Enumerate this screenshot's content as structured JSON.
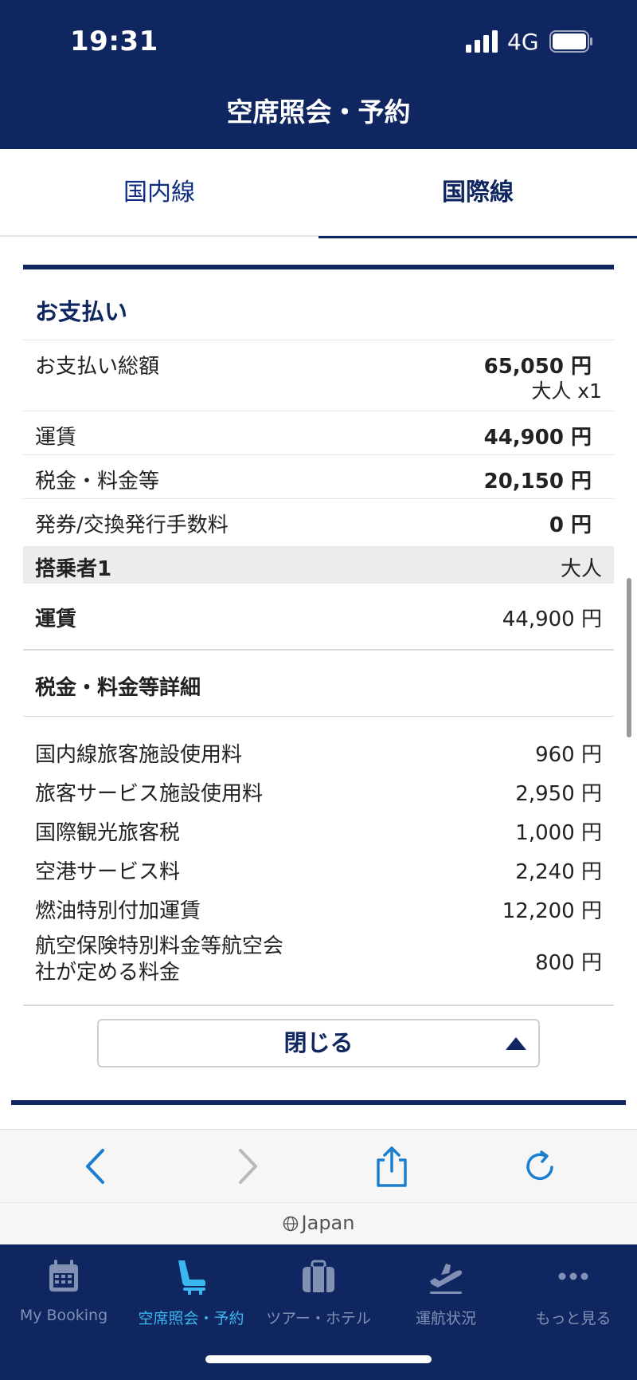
{
  "status": {
    "time": "19:31",
    "network": "4G"
  },
  "header": {
    "title": "空席照会・予約"
  },
  "tabs": [
    {
      "label": "国内線"
    },
    {
      "label": "国際線"
    }
  ],
  "payment": {
    "title": "お支払い",
    "total_label": "お支払い総額",
    "total_value": "65,050 円",
    "total_sub": "大人 x1",
    "fare_label": "運賃",
    "fare_value": "44,900 円",
    "tax_label": "税金・料金等",
    "tax_value": "20,150 円",
    "fee_label": "発券/交換発行手数料",
    "fee_value": "0 円"
  },
  "passenger": {
    "label": "搭乗者1",
    "type": "大人",
    "fare_label": "運賃",
    "fare_value": "44,900 円",
    "tax_details_title": "税金・料金等詳細",
    "details": [
      {
        "label": "国内線旅客施設使用料",
        "value": "960 円"
      },
      {
        "label": "旅客サービス施設使用料",
        "value": "2,950 円"
      },
      {
        "label": "国際観光旅客税",
        "value": "1,000 円"
      },
      {
        "label": "空港サービス料",
        "value": "2,240 円"
      },
      {
        "label": "燃油特別付加運賃",
        "value": "12,200 円"
      },
      {
        "label": "航空保険特別料金等航空会社が定める料金",
        "value": "800 円"
      }
    ]
  },
  "close_button": {
    "label": "閉じる"
  },
  "browser": {
    "domain": "Japan"
  },
  "nav": [
    {
      "label": "My Booking",
      "icon": "calendar-icon"
    },
    {
      "label": "空席照会・予約",
      "icon": "seat-icon"
    },
    {
      "label": "ツアー・ホテル",
      "icon": "suitcase-icon"
    },
    {
      "label": "運航状況",
      "icon": "plane-departure-icon"
    },
    {
      "label": "もっと見る",
      "icon": "more-dots-icon"
    }
  ],
  "colors": {
    "navy": "#0f2660",
    "active": "#3bb7f0"
  }
}
